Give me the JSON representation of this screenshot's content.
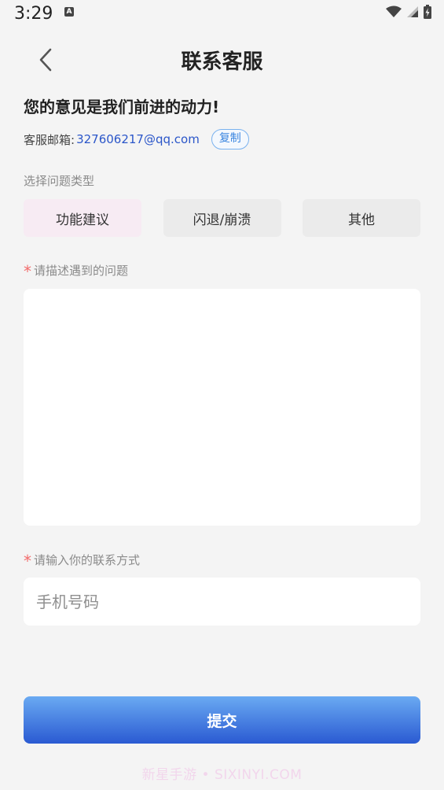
{
  "status_bar": {
    "time": "3:29",
    "app_badge": "A"
  },
  "header": {
    "title": "联系客服"
  },
  "slogan": "您的意见是我们前进的动力!",
  "email": {
    "label": "客服邮箱:",
    "value": "327606217@qq.com",
    "copy_label": "复制"
  },
  "type_section": {
    "label": "选择问题类型",
    "options": [
      {
        "label": "功能建议",
        "selected": true
      },
      {
        "label": "闪退/崩溃",
        "selected": false
      },
      {
        "label": "其他",
        "selected": false
      }
    ]
  },
  "description": {
    "required_mark": "*",
    "label": "请描述遇到的问题",
    "value": ""
  },
  "contact": {
    "required_mark": "*",
    "label": "请输入你的联系方式",
    "placeholder": "手机号码",
    "value": ""
  },
  "submit_label": "提交",
  "watermark": "新星手游 • SIXINYI.COM",
  "colors": {
    "accent": "#2a5ad2",
    "link": "#2b56c9",
    "required": "#f26b6b",
    "selected_option_bg": "#f7ebf3"
  },
  "icons": {
    "back": "chevron-left-icon",
    "wifi": "wifi-icon",
    "signal": "signal-icon",
    "battery": "battery-icon"
  }
}
